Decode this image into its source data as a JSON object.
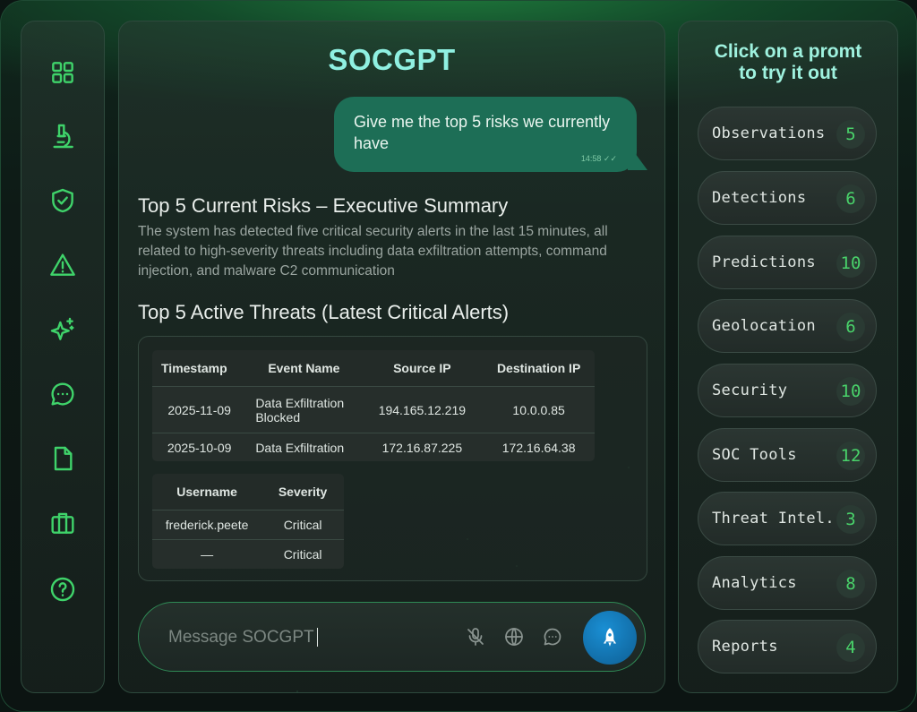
{
  "app": {
    "title": "SOCGPT"
  },
  "sidebar": {
    "items": [
      {
        "name": "dashboard",
        "icon": "grid-icon"
      },
      {
        "name": "lab",
        "icon": "microscope-icon"
      },
      {
        "name": "security",
        "icon": "shield-check-icon"
      },
      {
        "name": "alerts",
        "icon": "warning-icon"
      },
      {
        "name": "ai",
        "icon": "sparkles-icon"
      },
      {
        "name": "chat",
        "icon": "chat-icon"
      },
      {
        "name": "documents",
        "icon": "document-icon"
      },
      {
        "name": "cases",
        "icon": "briefcase-icon"
      },
      {
        "name": "help",
        "icon": "help-icon"
      }
    ]
  },
  "chat": {
    "user_message": "Give me the top 5 risks we currently have",
    "user_time": "14:58",
    "summary_title": "Top 5 Current Risks – Executive Summary",
    "summary_text": "The system has detected five critical security alerts in the last 15 minutes, all related to high-severity threats including data exfiltration attempts, command injection, and malware C2 communication",
    "threats_title": "Top 5 Active Threats (Latest Critical Alerts)",
    "table1": {
      "headers": [
        "Timestamp",
        "Event Name",
        "Source IP",
        "Destination IP"
      ],
      "rows": [
        [
          "2025-11-09",
          "Data Exfiltration Blocked",
          "194.165.12.219",
          "10.0.0.85"
        ],
        [
          "2025-10-09",
          "Data Exfiltration",
          "172.16.87.225",
          "172.16.64.38"
        ]
      ]
    },
    "table2": {
      "headers": [
        "Username",
        "Severity"
      ],
      "rows": [
        [
          "frederick.peete",
          "Critical"
        ],
        [
          "—",
          "Critical"
        ]
      ]
    }
  },
  "input": {
    "placeholder": "Message SOCGPT"
  },
  "prompts": {
    "title_line1": "Click on a promt",
    "title_line2": "to try it out",
    "items": [
      {
        "label": "Observations",
        "count": "5"
      },
      {
        "label": "Detections",
        "count": "6"
      },
      {
        "label": "Predictions",
        "count": "10"
      },
      {
        "label": "Geolocation",
        "count": "6"
      },
      {
        "label": "Security",
        "count": "10"
      },
      {
        "label": "SOC Tools",
        "count": "12"
      },
      {
        "label": "Threat Intel.",
        "count": "3"
      },
      {
        "label": "Analytics",
        "count": "8"
      },
      {
        "label": "Reports",
        "count": "4"
      }
    ]
  },
  "colors": {
    "accent": "#3fd36a",
    "bubble": "#1d6e56",
    "send": "#1a8fd4",
    "title": "#8ff0e1"
  }
}
